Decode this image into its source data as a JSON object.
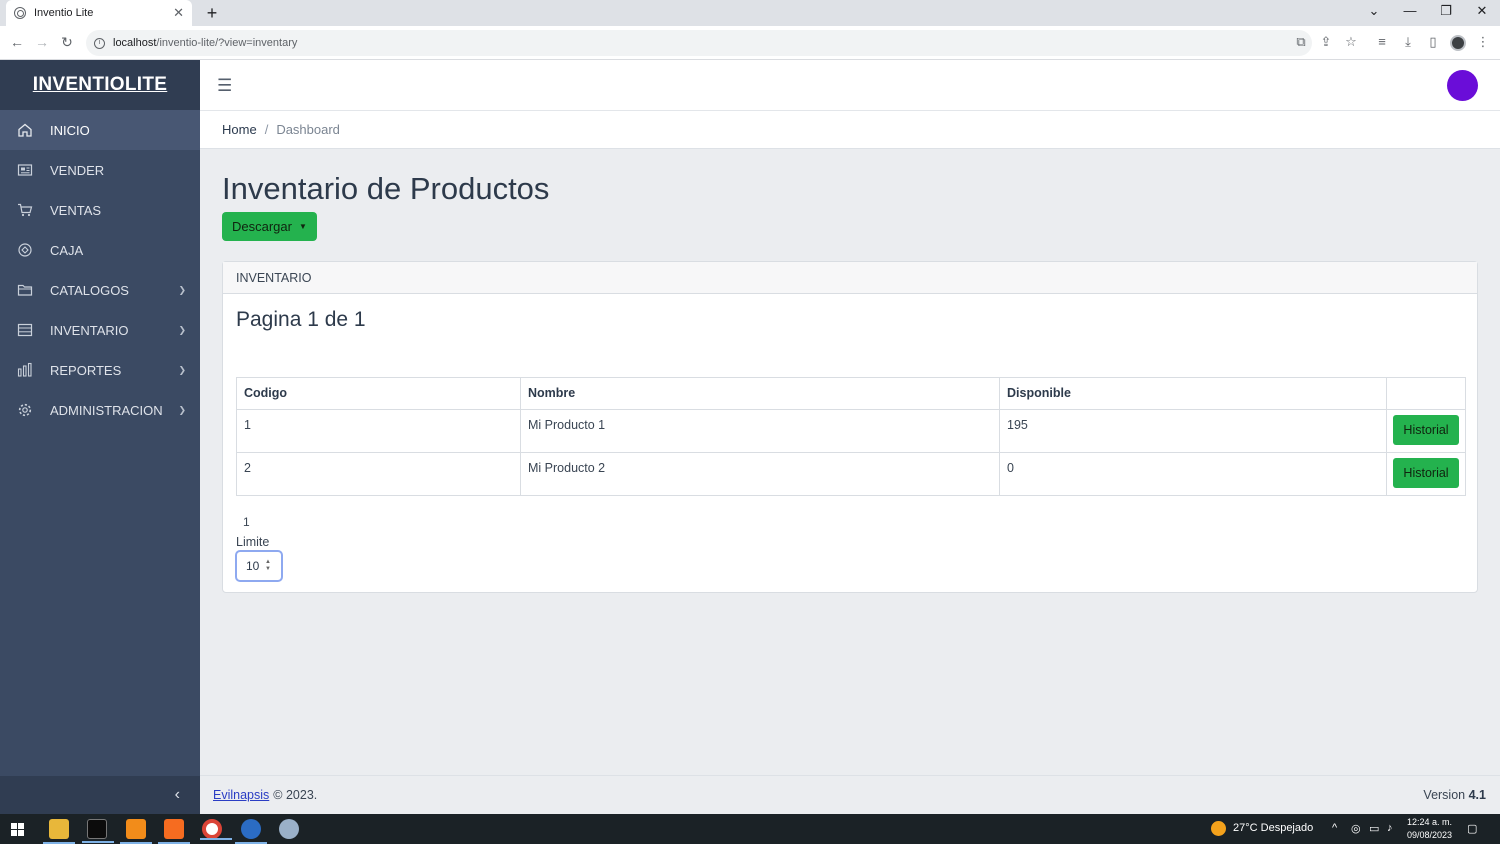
{
  "browser": {
    "tab_title": "Inventio Lite",
    "tab_close": "✕",
    "new_tab": "+",
    "url_host": "localhost",
    "url_path": "/inventio-lite/?view=inventary",
    "win_minimize": "—",
    "win_restore": "❐",
    "win_close": "✕",
    "win_menu": "⌄"
  },
  "sidebar": {
    "brand": "INVENTIOLITE",
    "items": [
      {
        "label": "INICIO",
        "icon": "home-icon"
      },
      {
        "label": "VENDER",
        "icon": "register-icon"
      },
      {
        "label": "VENTAS",
        "icon": "cart-icon"
      },
      {
        "label": "CAJA",
        "icon": "cash-icon"
      },
      {
        "label": "CATALOGOS",
        "icon": "folder-icon"
      },
      {
        "label": "INVENTARIO",
        "icon": "list-icon"
      },
      {
        "label": "REPORTES",
        "icon": "chart-icon"
      },
      {
        "label": "ADMINISTRACION",
        "icon": "gear-icon"
      }
    ],
    "collapse_glyph": "‹"
  },
  "topnav": {
    "hamburger": "☰",
    "avatar_color": "#6a0dd8"
  },
  "breadcrumb": {
    "home": "Home",
    "separator": "/",
    "current": "Dashboard"
  },
  "main": {
    "title": "Inventario de Productos",
    "download_label": "Descargar",
    "card": {
      "header": "INVENTARIO",
      "subtitle": "Pagina 1 de 1",
      "columns": [
        "Codigo",
        "Nombre",
        "Disponible",
        ""
      ],
      "rows": [
        {
          "codigo": "1",
          "nombre": "Mi Producto 1",
          "disponible": "195",
          "action": "Historial"
        },
        {
          "codigo": "2",
          "nombre": "Mi Producto 2",
          "disponible": "0",
          "action": "Historial"
        }
      ],
      "pager": "1",
      "limit_label": "Limite",
      "limit_value": "10"
    }
  },
  "footer": {
    "link": "Evilnapsis",
    "copyright": "© 2023.",
    "version_label": "Version",
    "version_number": "4.1"
  },
  "taskbar": {
    "weather": "27°C  Despejado",
    "time": "12:24 a. m.",
    "date": "09/08/2023"
  },
  "colors": {
    "sidebar": "#3b4a63",
    "brand_bg": "#303d52",
    "accent_green": "#24b24e",
    "content_bg": "#ebedf0"
  }
}
